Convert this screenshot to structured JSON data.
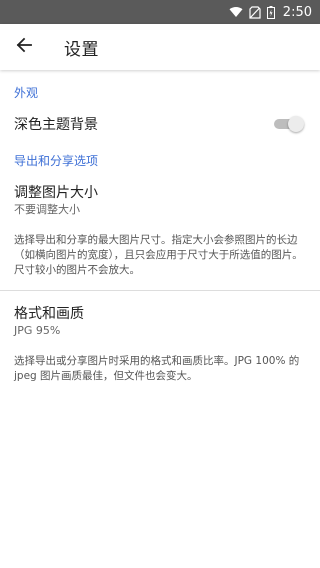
{
  "status_bar": {
    "time": "2:50",
    "icons": [
      "wifi-icon",
      "sim-off-icon",
      "battery-icon"
    ]
  },
  "app_bar": {
    "back_icon": "arrow-left-icon",
    "title": "设置"
  },
  "appearance": {
    "header": "外观",
    "dark_theme_label": "深色主题背景",
    "dark_theme_enabled": false
  },
  "export": {
    "header": "导出和分享选项",
    "resize": {
      "title": "调整图片大小",
      "summary": "不要调整大小",
      "description": "选择导出和分享的最大图片尺寸。指定大小会参照图片的长边（如横向图片的宽度），且只会应用于尺寸大于所选值的图片。尺寸较小的图片不会放大。"
    },
    "format": {
      "title": "格式和画质",
      "summary": "JPG 95%",
      "description": "选择导出或分享图片时采用的格式和画质比率。JPG 100% 的 jpeg 图片画质最佳，但文件也会变大。"
    }
  },
  "colors": {
    "status_bar": "#5a5a5a",
    "accent": "#3d6fd6"
  }
}
